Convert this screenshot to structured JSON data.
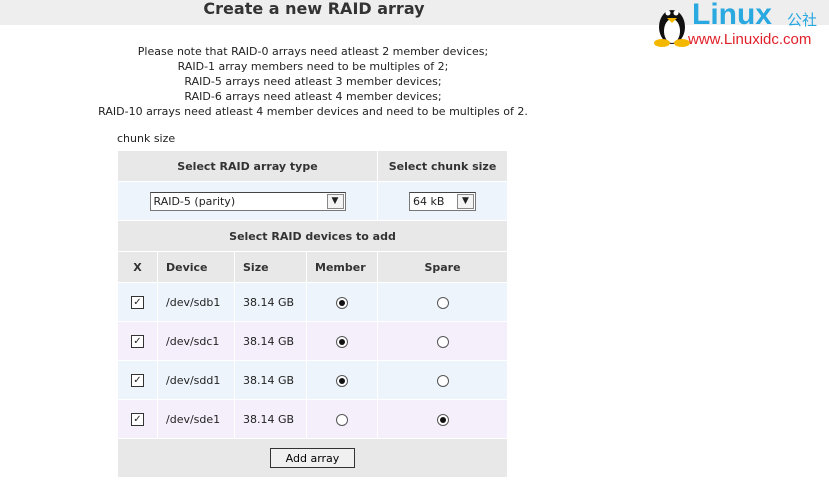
{
  "title": "Create a new RAID array",
  "notes": [
    "Please note that RAID-0 arrays need atleast 2 member devices;",
    "RAID-1 array members need to be multiples of 2;",
    "RAID-5 arrays need atleast 3 member devices;",
    "RAID-6 arrays need atleast 4 member devices;",
    "RAID-10 arrays need atleast 4 member devices and need to be multiples of 2."
  ],
  "chunk_label": "chunk size",
  "headers": {
    "type": "Select RAID array type",
    "chunk": "Select chunk size",
    "devices": "Select RAID devices to add"
  },
  "raid_type": "RAID-5 (parity)",
  "chunk_size": "64 kB",
  "columns": [
    "X",
    "Device",
    "Size",
    "Member",
    "Spare"
  ],
  "devices": [
    {
      "checked": true,
      "device": "/dev/sdb1",
      "size": "38.14 GB",
      "role": "member"
    },
    {
      "checked": true,
      "device": "/dev/sdc1",
      "size": "38.14 GB",
      "role": "member"
    },
    {
      "checked": true,
      "device": "/dev/sdd1",
      "size": "38.14 GB",
      "role": "member"
    },
    {
      "checked": true,
      "device": "/dev/sde1",
      "size": "38.14 GB",
      "role": "spare"
    }
  ],
  "add_button": "Add array",
  "watermark": {
    "brand": "Linux",
    "cn": "公社",
    "url": "www.Linuxidc.com"
  }
}
